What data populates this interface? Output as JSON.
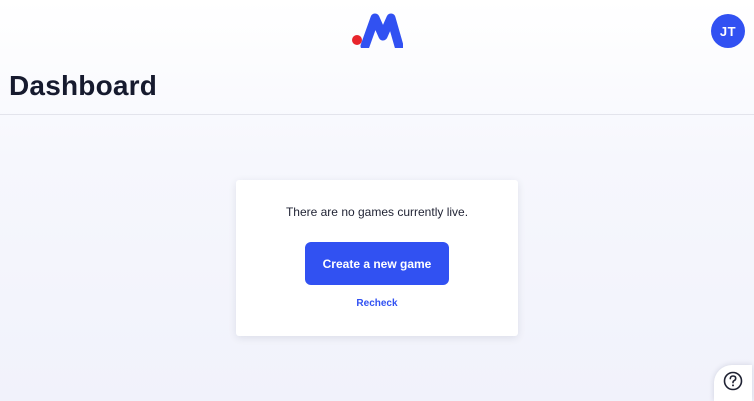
{
  "header": {
    "logo_icon": "brand-m-logo-icon",
    "brand_colors": {
      "dot": "#e8252c",
      "mark": "#3151f2"
    },
    "avatar_initials": "JT",
    "avatar_color": "#3151f2"
  },
  "page": {
    "title": "Dashboard"
  },
  "empty_state": {
    "message": "There are no games currently live.",
    "create_button_label": "Create a new game",
    "recheck_label": "Recheck"
  },
  "help": {
    "icon": "help-question-icon"
  },
  "colors": {
    "accent": "#3151f2",
    "title_text": "#161a2e",
    "background": "#f3f4fb"
  }
}
